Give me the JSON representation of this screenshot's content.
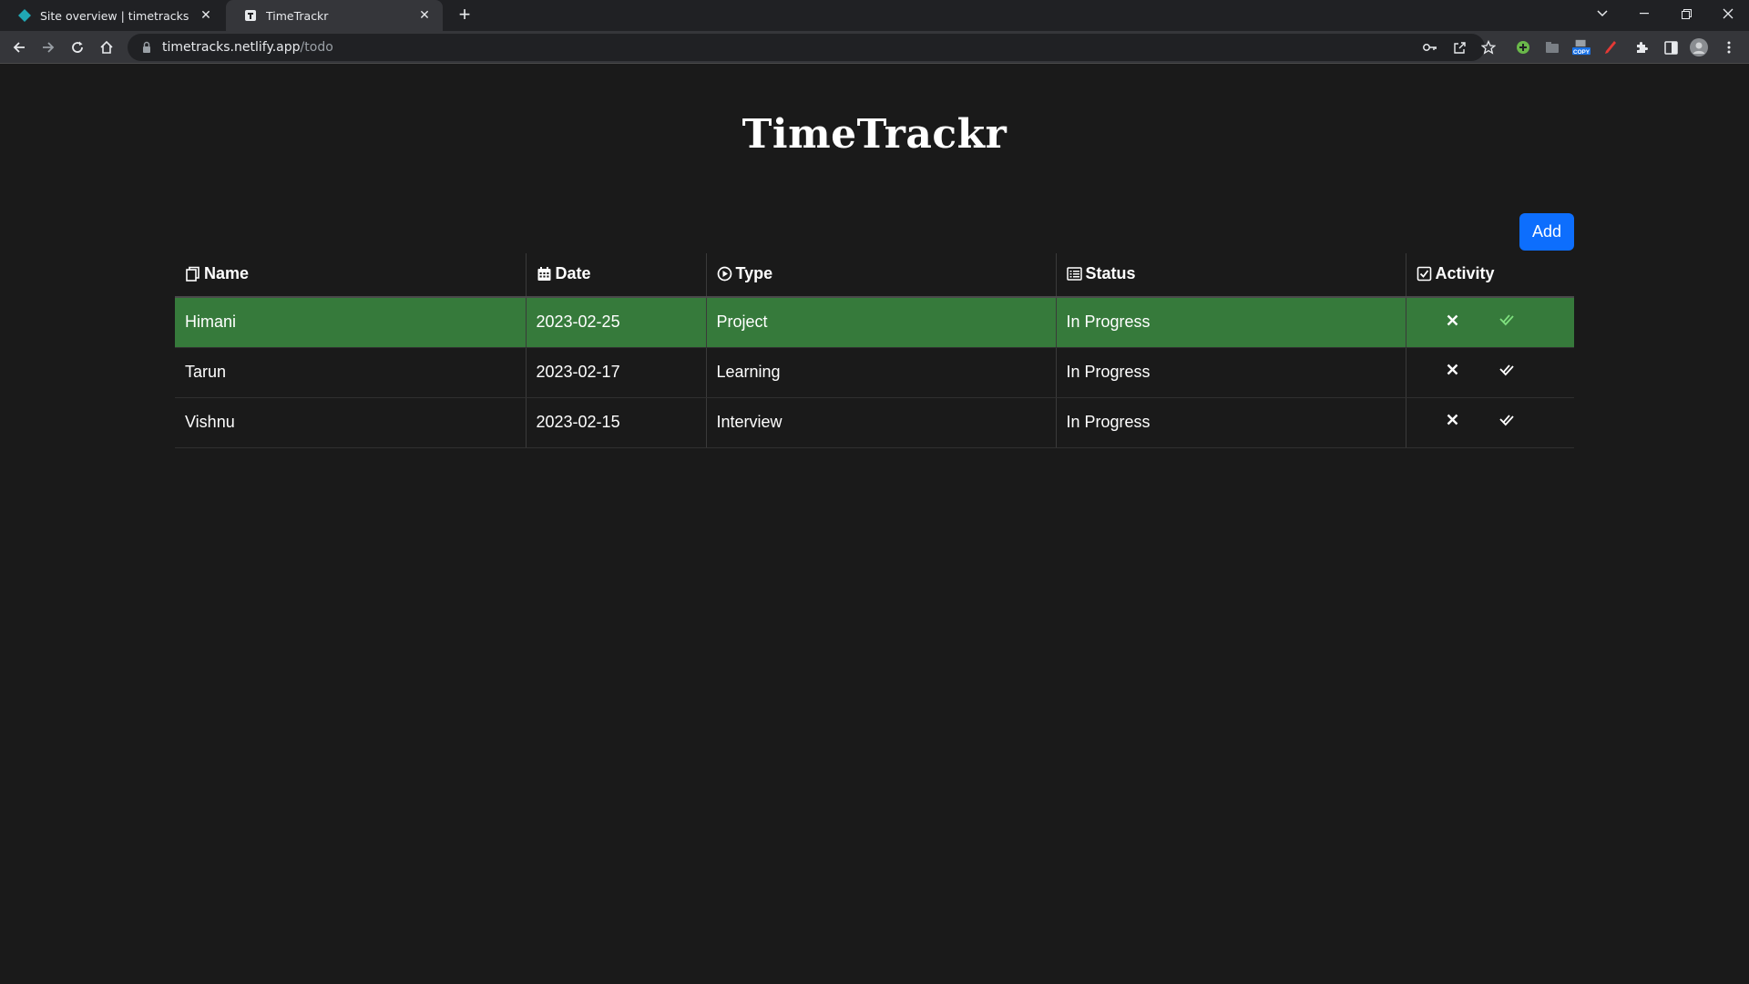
{
  "browser": {
    "tabs": [
      {
        "title": "Site overview | timetracks",
        "favicon": "netlify-icon",
        "active": false
      },
      {
        "title": "TimeTrackr",
        "favicon": "page-icon",
        "active": true
      }
    ],
    "url_host": "timetracks.netlify.app",
    "url_path": "/todo"
  },
  "page": {
    "title": "TimeTrackr",
    "add_label": "Add",
    "accent": "#0d6efd",
    "highlight_row_color": "#367a3b"
  },
  "table": {
    "headers": [
      {
        "label": "Name",
        "icon": "clipboard-icon"
      },
      {
        "label": "Date",
        "icon": "calendar-icon"
      },
      {
        "label": "Type",
        "icon": "play-circle-icon"
      },
      {
        "label": "Status",
        "icon": "list-icon"
      },
      {
        "label": "Activity",
        "icon": "check-square-icon"
      }
    ],
    "rows": [
      {
        "name": "Himani",
        "date": "2023-02-25",
        "type": "Project",
        "status": "In Progress",
        "highlighted": true
      },
      {
        "name": "Tarun",
        "date": "2023-02-17",
        "type": "Learning",
        "status": "In Progress",
        "highlighted": false
      },
      {
        "name": "Vishnu",
        "date": "2023-02-15",
        "type": "Interview",
        "status": "In Progress",
        "highlighted": false
      }
    ]
  }
}
